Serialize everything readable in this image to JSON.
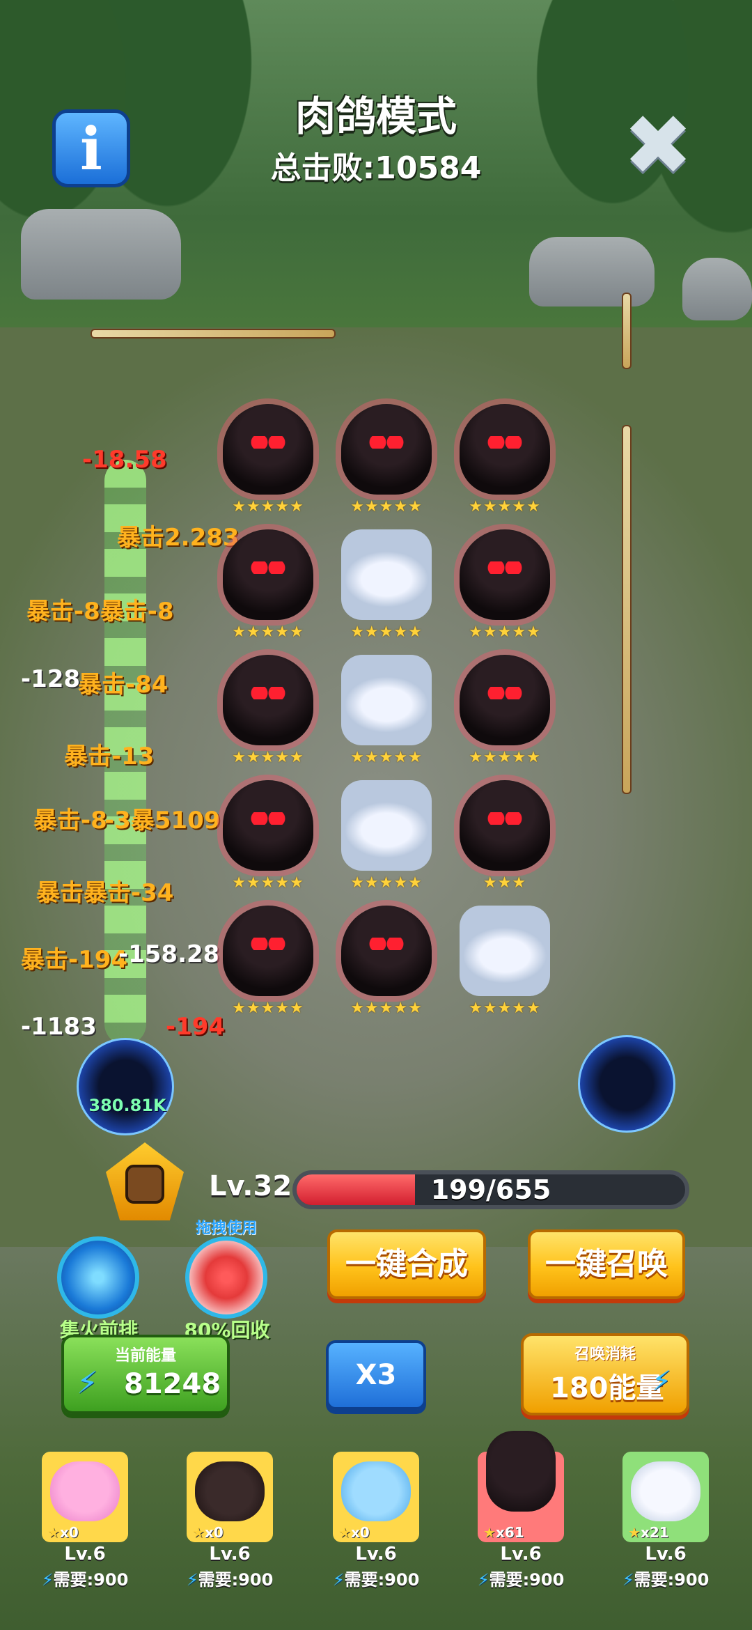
{
  "header": {
    "title": "肉鸽模式",
    "total_kills": "总击败:10584",
    "info_icon": "info-icon",
    "close_icon": "close-icon"
  },
  "board": {
    "rows": [
      [
        {
          "unit": "reaper",
          "stars": "★★★★★"
        },
        {
          "unit": "reaper",
          "stars": "★★★★★"
        },
        {
          "unit": "reaper",
          "stars": "★★★★★"
        }
      ],
      [
        {
          "unit": "reaper",
          "stars": "★★★★★"
        },
        {
          "unit": "wolf",
          "stars": "★★★★★"
        },
        {
          "unit": "reaper",
          "stars": "★★★★★"
        }
      ],
      [
        {
          "unit": "reaper",
          "stars": "★★★★★"
        },
        {
          "unit": "wolf",
          "stars": "★★★★★"
        },
        {
          "unit": "reaper",
          "stars": "★★★★★"
        }
      ],
      [
        {
          "unit": "reaper",
          "stars": "★★★★★"
        },
        {
          "unit": "wolf",
          "stars": "★★★★★"
        },
        {
          "unit": "reaper",
          "stars": "★★★"
        }
      ],
      [
        {
          "unit": "reaper",
          "stars": "★★★★★"
        },
        {
          "unit": "reaper",
          "stars": "★★★★★"
        },
        {
          "unit": "wolf",
          "stars": "★★★★★"
        }
      ]
    ]
  },
  "damage_numbers": [
    {
      "text": "-18.58",
      "style": "red"
    },
    {
      "text": "暴击2.283",
      "style": "crit"
    },
    {
      "text": "暴击-8暴击-8",
      "style": "crit"
    },
    {
      "text": "-128",
      "style": "white"
    },
    {
      "text": "暴击-84",
      "style": "crit"
    },
    {
      "text": "暴击-13",
      "style": "crit"
    },
    {
      "text": "暴击-8",
      "style": "crit"
    },
    {
      "text": "-3暴5109.1",
      "style": "crit"
    },
    {
      "text": "暴击暴击-34",
      "style": "crit"
    },
    {
      "text": "暴击-194",
      "style": "crit"
    },
    {
      "text": "-158.28",
      "style": "white"
    },
    {
      "text": "-1183",
      "style": "white"
    },
    {
      "text": "-194",
      "style": "red"
    }
  ],
  "portal_left_label": "380.81K",
  "level": {
    "label": "Lv.32",
    "xp_text": "199/655",
    "xp_fraction": 0.304
  },
  "skills": {
    "focus_label": "集火前排",
    "recycle_label": "80%回收",
    "drag_hint": "拖拽使用"
  },
  "buttons": {
    "merge": "一键合成",
    "summon": "一键召唤",
    "speed": "X3"
  },
  "energy": {
    "label": "当前能量",
    "value": "81248"
  },
  "summon_cost": {
    "label": "召唤消耗",
    "value": "180能量"
  },
  "cards": [
    {
      "name": "pink-axolotl",
      "count": "x0",
      "level": "Lv.6",
      "need": "需要:900",
      "bg": "#ffd84a"
    },
    {
      "name": "dark-boar",
      "count": "x0",
      "level": "Lv.6",
      "need": "需要:900",
      "bg": "#ffd84a"
    },
    {
      "name": "blue-slime",
      "count": "x0",
      "level": "Lv.6",
      "need": "需要:900",
      "bg": "#ffd84a"
    },
    {
      "name": "reaper",
      "count": "x61",
      "level": "Lv.6",
      "need": "需要:900",
      "bg": "#ff7a7a"
    },
    {
      "name": "white-wolf",
      "count": "x21",
      "level": "Lv.6",
      "need": "需要:900",
      "bg": "#8fe07a"
    }
  ],
  "colors": {
    "accent_yellow": "#ffc21a",
    "energy_green": "#3ea020",
    "xp_red": "#d21f2f",
    "blue_button": "#1f6fd8"
  }
}
